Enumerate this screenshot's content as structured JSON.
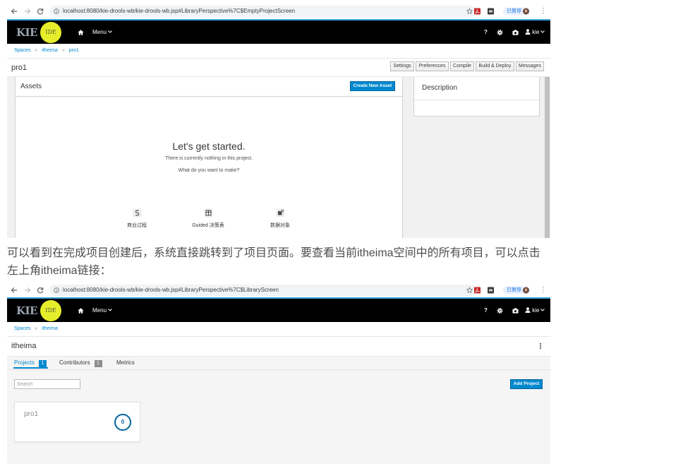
{
  "header": {
    "logo_text": "KIE",
    "logo_badge": "IDE",
    "menu_label": "Menu",
    "help_label": "?",
    "user_label": "kie"
  },
  "breadcrumb_separator": "»",
  "shot1": {
    "browser": {
      "url": "localhost:8080/kie-drools-wb/kie-drools-wb.jsp#LibraryPerspective%7C$EmptyProjectScreen",
      "profile_status": "已暂停"
    },
    "breadcrumb": [
      "Spaces",
      "itheima",
      "pro1"
    ],
    "title": "pro1",
    "toolbar": [
      "Settings",
      "Preferences",
      "Compile",
      "Build & Deploy",
      "Messages"
    ],
    "assets": {
      "title": "Assets",
      "create_button": "Create New Asset",
      "empty_heading": "Let's get started.",
      "empty_line1": "There is currently nothing in this project.",
      "empty_line2": "What do you want to make?",
      "options": [
        {
          "label": "商业过程",
          "icon": "process-icon"
        },
        {
          "label": "Guided 决策表",
          "icon": "decision-table-icon"
        },
        {
          "label": "数据对象",
          "icon": "data-object-icon"
        }
      ]
    },
    "description": {
      "title": "Description"
    }
  },
  "paragraph": {
    "line1": "可以看到在完成项目创建后，系统直接跳转到了项目页面。要查看当前itheima空间中的所有项目，可以点击",
    "line2": "左上角itheima链接："
  },
  "shot2": {
    "browser": {
      "url": "localhost:8080/kie-drools-wb/kie-drools-wb.jsp#LibraryPerspective%7C$LibraryScreen",
      "profile_status": "已暂停"
    },
    "breadcrumb": [
      "Spaces",
      "itheima"
    ],
    "title": "itheima",
    "tabs": [
      {
        "label": "Projects",
        "count": "1",
        "active": true
      },
      {
        "label": "Contributors",
        "count": "1"
      },
      {
        "label": "Metrics"
      }
    ],
    "search": {
      "placeholder": "Search"
    },
    "add_button": "Add Project",
    "projects": [
      {
        "name": "pro1",
        "asset_count": "0"
      }
    ]
  },
  "colors": {
    "accent": "#0088ce",
    "header_bg": "#000000",
    "header_border": "#39a5dc",
    "logo_badge": "#e6ee2c"
  }
}
